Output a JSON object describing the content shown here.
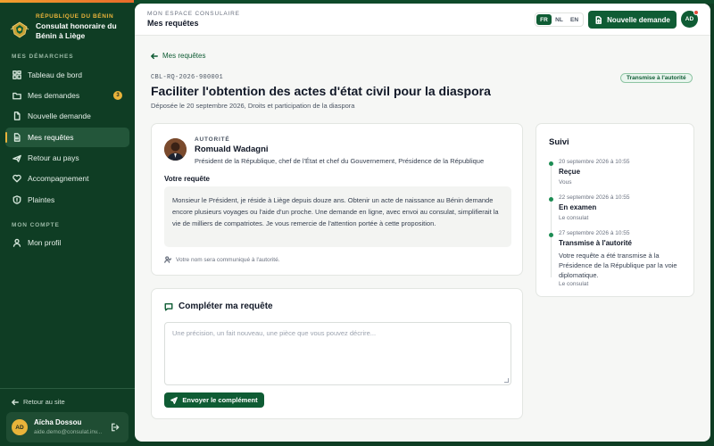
{
  "sidebar": {
    "kicker": "RÉPUBLIQUE DU BÉNIN",
    "brand_name": "Consulat honoraire du Bénin à Liège",
    "section_1": "MES DÉMARCHES",
    "items": [
      {
        "label": "Tableau de bord",
        "icon": "grid-icon"
      },
      {
        "label": "Mes demandes",
        "icon": "folder-icon",
        "badge": "3"
      },
      {
        "label": "Nouvelle demande",
        "icon": "file-icon"
      },
      {
        "label": "Mes requêtes",
        "icon": "document-icon",
        "active": true
      },
      {
        "label": "Retour au pays",
        "icon": "plane-icon"
      },
      {
        "label": "Accompagnement",
        "icon": "heart-handshake-icon"
      },
      {
        "label": "Plaintes",
        "icon": "alert-shield-icon"
      }
    ],
    "section_2": "MON COMPTE",
    "account_item": {
      "label": "Mon profil",
      "icon": "user-icon"
    },
    "back_link": "Retour au site",
    "user": {
      "initials": "AD",
      "name": "Aïcha Dossou",
      "email": "aide.demo@consulat.inv..."
    }
  },
  "topbar": {
    "kicker": "MON ESPACE CONSULAIRE",
    "title": "Mes requêtes",
    "languages": [
      "FR",
      "NL",
      "EN"
    ],
    "active_language": "FR",
    "new_button": "Nouvelle demande",
    "avatar_initials": "AD"
  },
  "page": {
    "breadcrumb": "Mes requêtes",
    "reference": "CBL-RQ-2026-900001",
    "status": "Transmise à l'autorité",
    "title": "Faciliter l'obtention des actes d'état civil pour la diaspora",
    "subtitle": "Déposée le 20 septembre 2026, Droits et participation de la diaspora"
  },
  "request_card": {
    "authority_kicker": "AUTORITÉ",
    "authority_name": "Romuald Wadagni",
    "authority_role": "Président de la République, chef de l'État et chef du Gouvernement, Présidence de la République",
    "section_title": "Votre requête",
    "message": "Monsieur le Président, je réside à Liège depuis douze ans. Obtenir un acte de naissance au Bénin demande encore plusieurs voyages ou l'aide d'un proche. Une demande en ligne, avec envoi au consulat, simplifierait la vie de milliers de compatriotes. Je vous remercie de l'attention portée à cette proposition.",
    "anonymity_note": "Votre nom sera communiqué à l'autorité."
  },
  "complement": {
    "title": "Compléter ma requête",
    "placeholder": "Une précision, un fait nouveau, une pièce que vous pouvez décrire...",
    "button": "Envoyer le complément"
  },
  "suivi": {
    "title": "Suivi",
    "events": [
      {
        "date": "20 septembre 2026 à 10:55",
        "title": "Reçue",
        "text": "",
        "who": "Vous"
      },
      {
        "date": "22 septembre 2026 à 10:55",
        "title": "En examen",
        "text": "",
        "who": "Le consulat"
      },
      {
        "date": "27 septembre 2026 à 10:55",
        "title": "Transmise à l'autorité",
        "text": "Votre requête a été transmise à la Présidence de la République par la voie diplomatique.",
        "who": "Le consulat"
      }
    ]
  },
  "colors": {
    "brand_green": "#0f5c34",
    "sidebar_bg": "#0f3d24",
    "accent_gold": "#e9b33a",
    "status_green": "#1c8c53"
  }
}
